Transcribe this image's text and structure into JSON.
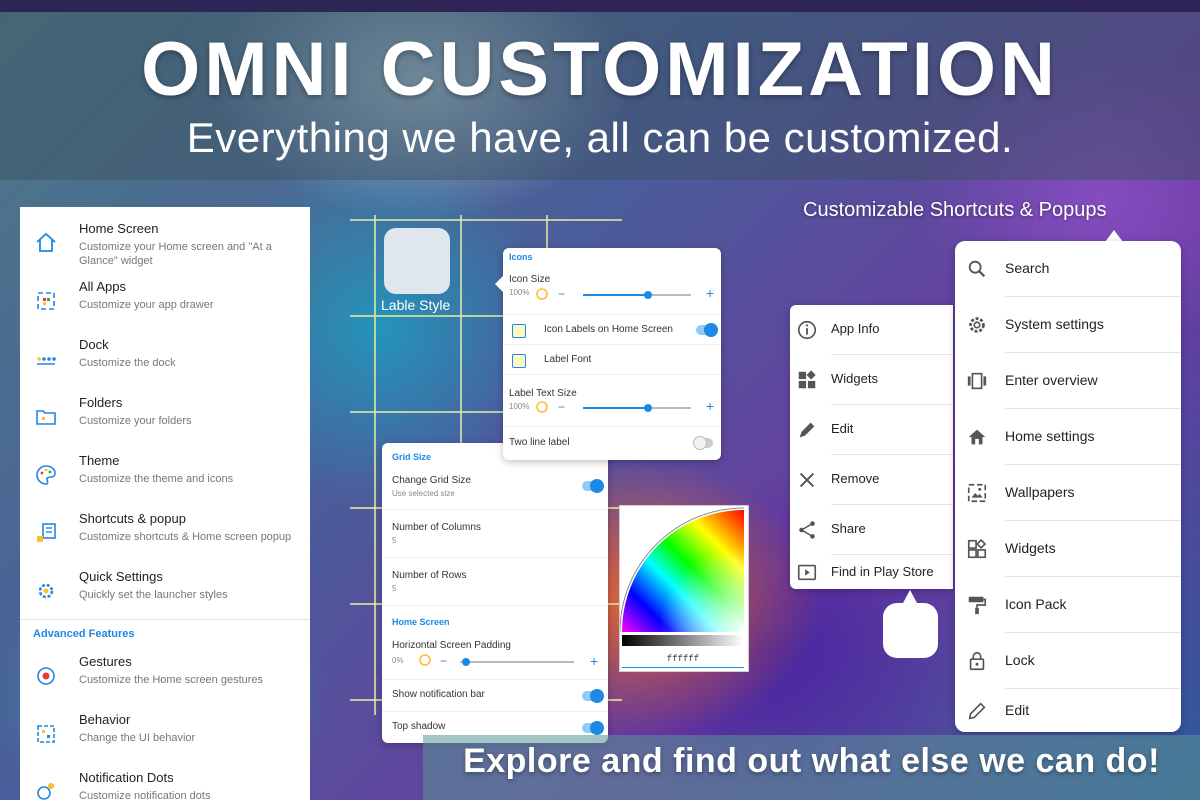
{
  "hero": {
    "title": "OMNI CUSTOMIZATION",
    "subtitle": "Everything we have, all can be customized."
  },
  "settings": {
    "items": [
      {
        "title": "Home Screen",
        "desc": "Customize your Home screen and \"At a Glance\" widget",
        "icon": "home-icon"
      },
      {
        "title": "All Apps",
        "desc": "Customize your app drawer",
        "icon": "app-drawer-icon"
      },
      {
        "title": "Dock",
        "desc": "Customize the dock",
        "icon": "dock-icon"
      },
      {
        "title": "Folders",
        "desc": "Customize your folders",
        "icon": "folder-icon"
      },
      {
        "title": "Theme",
        "desc": "Customize the theme and icons",
        "icon": "palette-icon"
      },
      {
        "title": "Shortcuts & popup",
        "desc": "Customize shortcuts & Home screen popup",
        "icon": "shortcuts-icon"
      },
      {
        "title": "Quick Settings",
        "desc": "Quickly set the launcher styles",
        "icon": "gear-icon"
      }
    ],
    "advanced_heading": "Advanced Features",
    "advanced_items": [
      {
        "title": "Gestures",
        "desc": "Customize the Home screen gestures",
        "icon": "gesture-icon"
      },
      {
        "title": "Behavior",
        "desc": "Change the UI behavior",
        "icon": "behavior-icon"
      },
      {
        "title": "Notification Dots",
        "desc": "Customize notification dots",
        "icon": "notification-dot-icon"
      }
    ]
  },
  "preview": {
    "label": "Lable Style"
  },
  "icons_popup": {
    "heading": "Icons",
    "icon_size_label": "Icon Size",
    "icon_size_value": "100%",
    "icon_size_fraction": 0.6,
    "labels_toggle": "Icon Labels on Home Screen",
    "labels_toggle_on": true,
    "label_font": "Label Font",
    "label_text_size_label": "Label Text Size",
    "label_text_size_value": "100%",
    "label_text_size_fraction": 0.6,
    "two_line": "Two line label",
    "two_line_on": false
  },
  "grid_popup": {
    "section1": "Grid Size",
    "change_grid": "Change Grid Size",
    "change_grid_desc": "Use selected size",
    "columns_label": "Number of Columns",
    "columns_value": "5",
    "rows_label": "Number of Rows",
    "rows_value": "5",
    "section2": "Home Screen",
    "padding_label": "Horizontal Screen Padding",
    "padding_value": "0%",
    "notif_bar": "Show notification bar",
    "top_shadow": "Top shadow"
  },
  "color_picker": {
    "hex": "ffffff"
  },
  "app_popup": {
    "items": [
      {
        "label": "App Info",
        "icon": "info-icon"
      },
      {
        "label": "Widgets",
        "icon": "widgets-icon"
      },
      {
        "label": "Edit",
        "icon": "pencil-icon"
      },
      {
        "label": "Remove",
        "icon": "close-icon"
      },
      {
        "label": "Share",
        "icon": "share-icon"
      },
      {
        "label": "Find in Play Store",
        "icon": "play-store-icon"
      }
    ]
  },
  "shortcut_menu": {
    "heading": "Customizable Shortcuts & Popups",
    "items": [
      {
        "label": "Search",
        "icon": "search-icon"
      },
      {
        "label": "System settings",
        "icon": "gear-icon"
      },
      {
        "label": "Enter overview",
        "icon": "overview-icon"
      },
      {
        "label": "Home settings",
        "icon": "home-icon"
      },
      {
        "label": "Wallpapers",
        "icon": "wallpaper-icon"
      },
      {
        "label": "Widgets",
        "icon": "widgets-icon"
      },
      {
        "label": "Icon Pack",
        "icon": "paint-roller-icon"
      },
      {
        "label": "Lock",
        "icon": "lock-icon"
      },
      {
        "label": "Edit",
        "icon": "pencil-icon"
      }
    ]
  },
  "bottom": {
    "text": "Explore and find out what else we can do!"
  },
  "colors": {
    "accent": "#1e88e5",
    "grid_line": "#e8f0a0",
    "panel": "#ffffff"
  }
}
